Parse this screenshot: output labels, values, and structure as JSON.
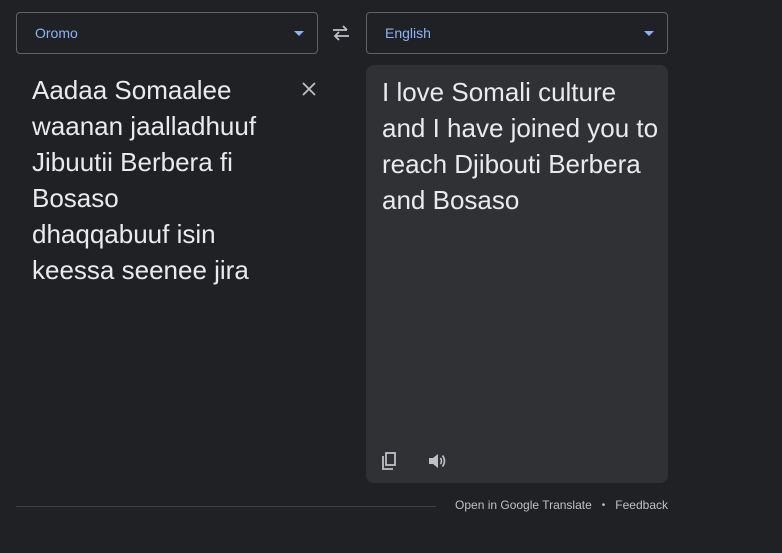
{
  "source_language": "Oromo",
  "target_language": "English",
  "source_text": "Aadaa Somaalee waanan jaalladhuuf Jibuutii Berbera fi Bosaso dhaqqabuuf isin keessa seenee jira",
  "translated_text": "I love Somali culture and I have joined you to reach Djibouti Berbera and Bosaso",
  "icons": {
    "dropdown": "chevron-down-icon",
    "swap": "swap-languages-icon",
    "clear": "close-icon",
    "copy": "copy-icon",
    "listen": "speaker-icon"
  },
  "footer": {
    "open_link": "Open in Google Translate",
    "separator": "•",
    "feedback_link": "Feedback"
  },
  "colors": {
    "background": "#202124",
    "panel": "#303134",
    "accent": "#8ab4f8",
    "text": "#e8eaed"
  }
}
